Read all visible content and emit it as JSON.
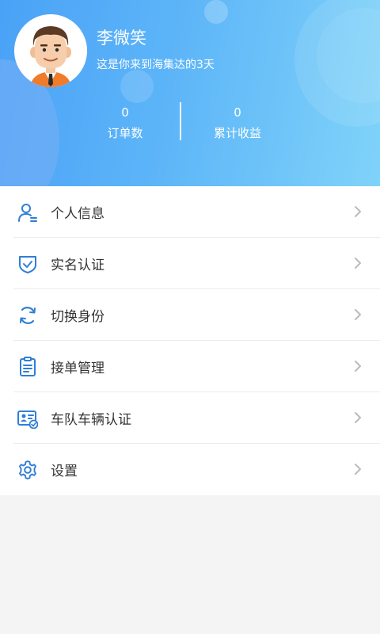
{
  "profile": {
    "name": "李微笑",
    "subtitle": "这是你来到海集达的3天"
  },
  "stats": {
    "orders": {
      "value": "0",
      "label": "订单数"
    },
    "income": {
      "value": "0",
      "label": "累计收益"
    }
  },
  "menu": {
    "items": [
      {
        "label": "个人信息",
        "icon": "person-icon"
      },
      {
        "label": "实名认证",
        "icon": "shield-check-icon"
      },
      {
        "label": "切换身份",
        "icon": "refresh-icon"
      },
      {
        "label": "接单管理",
        "icon": "clipboard-icon"
      },
      {
        "label": "车队车辆认证",
        "icon": "id-card-icon"
      },
      {
        "label": "设置",
        "icon": "gear-icon"
      }
    ]
  },
  "colors": {
    "header_start": "#4aa2f7",
    "header_end": "#7fd3f9",
    "icon": "#2f7fd6",
    "text": "#333333",
    "chevron": "#bbbbbb"
  }
}
